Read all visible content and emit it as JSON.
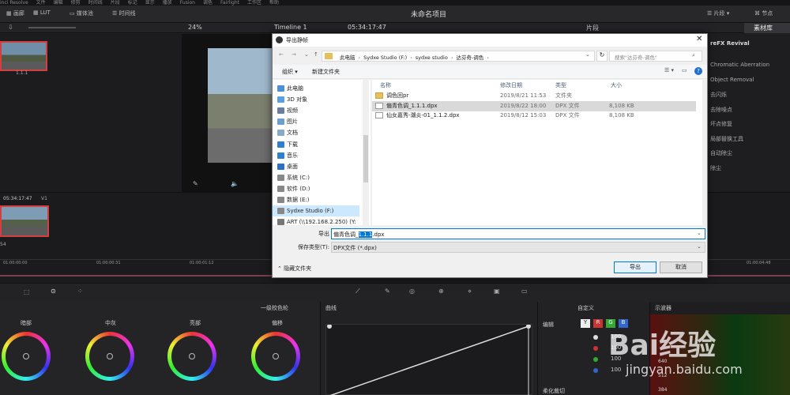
{
  "menubar": {
    "items": [
      "inci Resolve",
      "文件",
      "编辑",
      "修剪",
      "时间线",
      "片段",
      "标记",
      "显示",
      "播放",
      "Fusion",
      "调色",
      "Fairlight",
      "工作区",
      "帮助"
    ]
  },
  "titlebar": {
    "buttons": [
      "画廊",
      "LUT",
      "媒体池",
      "时间线"
    ],
    "project": "未命名项目",
    "right_buttons": [
      "片段",
      "节点"
    ]
  },
  "toolbar2": {
    "zoom": "24%",
    "timeline": "Timeline 1",
    "timecode": "05:34:17:47",
    "clip": "片段",
    "tab": "素材库"
  },
  "left": {
    "clip1": "1.1.1",
    "clip2_tc": "05:34:17:47",
    "clip2_track": "V1",
    "clip2_num": "54"
  },
  "ruler": [
    "01:00:00:00",
    "01:00:00:31",
    "01:00:01:12",
    "01:00:04:48"
  ],
  "fx": {
    "title": "reFX Revival",
    "items": [
      "Chromatic Aberration",
      "Object Removal",
      "去闪烁",
      "去除噪点",
      "坏点修复",
      "局部替换工具",
      "自动除尘",
      "除尘"
    ]
  },
  "color": {
    "wheels_mode": "一级校色轮",
    "wheels": [
      "暗部",
      "中灰",
      "亮部",
      "偏移"
    ],
    "curve_title": "曲线",
    "curve_mode": "自定义",
    "edit_label": "编辑",
    "channels": [
      "Y",
      "R",
      "G",
      "B"
    ],
    "values": [
      "100",
      "100",
      "100",
      "100"
    ],
    "soft": "柔化裁切",
    "scope": "示波器",
    "scope_nums": [
      "768",
      "640",
      "512",
      "384"
    ]
  },
  "dialog": {
    "title": "导出静帧",
    "path": [
      "此电脑",
      "Sydxe Studio (F:)",
      "sydxe studio",
      "达芬奇-调色"
    ],
    "search_placeholder": "搜索\"达芬奇-调色\"",
    "organize": "组织",
    "new_folder": "新建文件夹",
    "columns": [
      "名称",
      "修改日期",
      "类型",
      "大小"
    ],
    "files": [
      {
        "name": "调色回pr",
        "date": "2019/8/21 11:53",
        "type": "文件夹",
        "size": "",
        "kind": "folder"
      },
      {
        "name": "偏青色调_1.1.1.dpx",
        "date": "2019/8/22 18:00",
        "type": "DPX 文件",
        "size": "8,108 KB",
        "kind": "file",
        "selected": true
      },
      {
        "name": "仙女嘉秀-潮炎-01_1.1.2.dpx",
        "date": "2019/8/12 15:03",
        "type": "DPX 文件",
        "size": "8,108 KB",
        "kind": "file"
      }
    ],
    "tree": [
      {
        "label": "此电脑",
        "color": "#4a8fd8"
      },
      {
        "label": "3D 对象",
        "color": "#5aa0e0"
      },
      {
        "label": "视频",
        "color": "#6a7fa0"
      },
      {
        "label": "图片",
        "color": "#6a9fd0"
      },
      {
        "label": "文档",
        "color": "#8aa8c8"
      },
      {
        "label": "下载",
        "color": "#2f7fd0"
      },
      {
        "label": "音乐",
        "color": "#2f7fd0"
      },
      {
        "label": "桌面",
        "color": "#2a70c8"
      },
      {
        "label": "系统 (C:)",
        "color": "#888"
      },
      {
        "label": "软件 (D:)",
        "color": "#888"
      },
      {
        "label": "数据 (E:)",
        "color": "#888"
      },
      {
        "label": "Sydxe Studio (F:)",
        "color": "#888",
        "selected": true
      },
      {
        "label": "ART (\\\\192.168.2.250) (Y:",
        "color": "#777"
      }
    ],
    "filename_label": "导出",
    "filename_pre": "偏青色调_",
    "filename_sel": "1.1.1",
    "filename_post": ".dpx",
    "type_label": "保存类型(T):",
    "type_value": "DPX文件 (*.dpx)",
    "hide_folders": "隐藏文件夹",
    "export_btn": "导出",
    "cancel_btn": "取消"
  },
  "watermark": {
    "text": "Bai经验",
    "url": "jingyan.baidu.com"
  }
}
